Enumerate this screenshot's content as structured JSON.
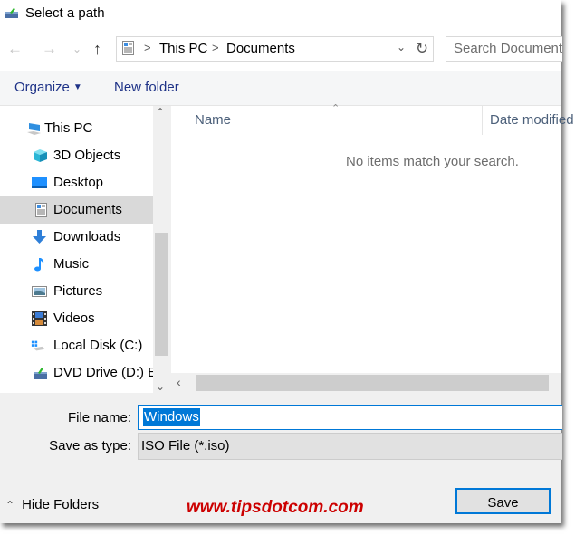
{
  "window": {
    "title": "Select a path",
    "title_icon": "disc-burn-icon"
  },
  "navigation": {
    "back_icon": "arrow-left-icon",
    "forward_icon": "arrow-right-icon",
    "recent_icon": "chevron-down-icon",
    "up_icon": "arrow-up-icon",
    "address": {
      "location_icon": "documents-icon",
      "breadcrumbs": [
        "This PC",
        "Documents"
      ],
      "separator": ">"
    },
    "refresh_icon": "refresh-icon",
    "search": {
      "placeholder": "Search Documents"
    }
  },
  "toolbar": {
    "organize_label": "Organize",
    "new_folder_label": "New folder"
  },
  "sidebar": {
    "items": [
      {
        "label": "This PC",
        "icon": "computer-icon",
        "selected": false
      },
      {
        "label": "3D Objects",
        "icon": "cube-icon",
        "selected": false
      },
      {
        "label": "Desktop",
        "icon": "desktop-icon",
        "selected": false
      },
      {
        "label": "Documents",
        "icon": "documents-icon",
        "selected": true
      },
      {
        "label": "Downloads",
        "icon": "download-arrow-icon",
        "selected": false
      },
      {
        "label": "Music",
        "icon": "music-note-icon",
        "selected": false
      },
      {
        "label": "Pictures",
        "icon": "pictures-icon",
        "selected": false
      },
      {
        "label": "Videos",
        "icon": "film-strip-icon",
        "selected": false
      },
      {
        "label": "Local Disk (C:)",
        "icon": "hard-drive-icon",
        "selected": false
      },
      {
        "label": "DVD Drive (D:) E",
        "icon": "dvd-drive-icon",
        "selected": false
      }
    ]
  },
  "file_list": {
    "columns": [
      "Name",
      "Date modified"
    ],
    "empty_message": "No items match your search."
  },
  "form": {
    "file_name_label": "File name:",
    "file_name_value": "Windows",
    "save_as_type_label": "Save as type:",
    "save_as_type_value": "ISO File (*.iso)"
  },
  "footer": {
    "hide_folders_label": "Hide Folders",
    "watermark": "www.tipsdotcom.com",
    "save_label": "Save"
  },
  "colors": {
    "accent": "#0078d7",
    "selection_bg": "#d9d9d9",
    "watermark": "#cc0000",
    "link_text": "#1e3287"
  }
}
